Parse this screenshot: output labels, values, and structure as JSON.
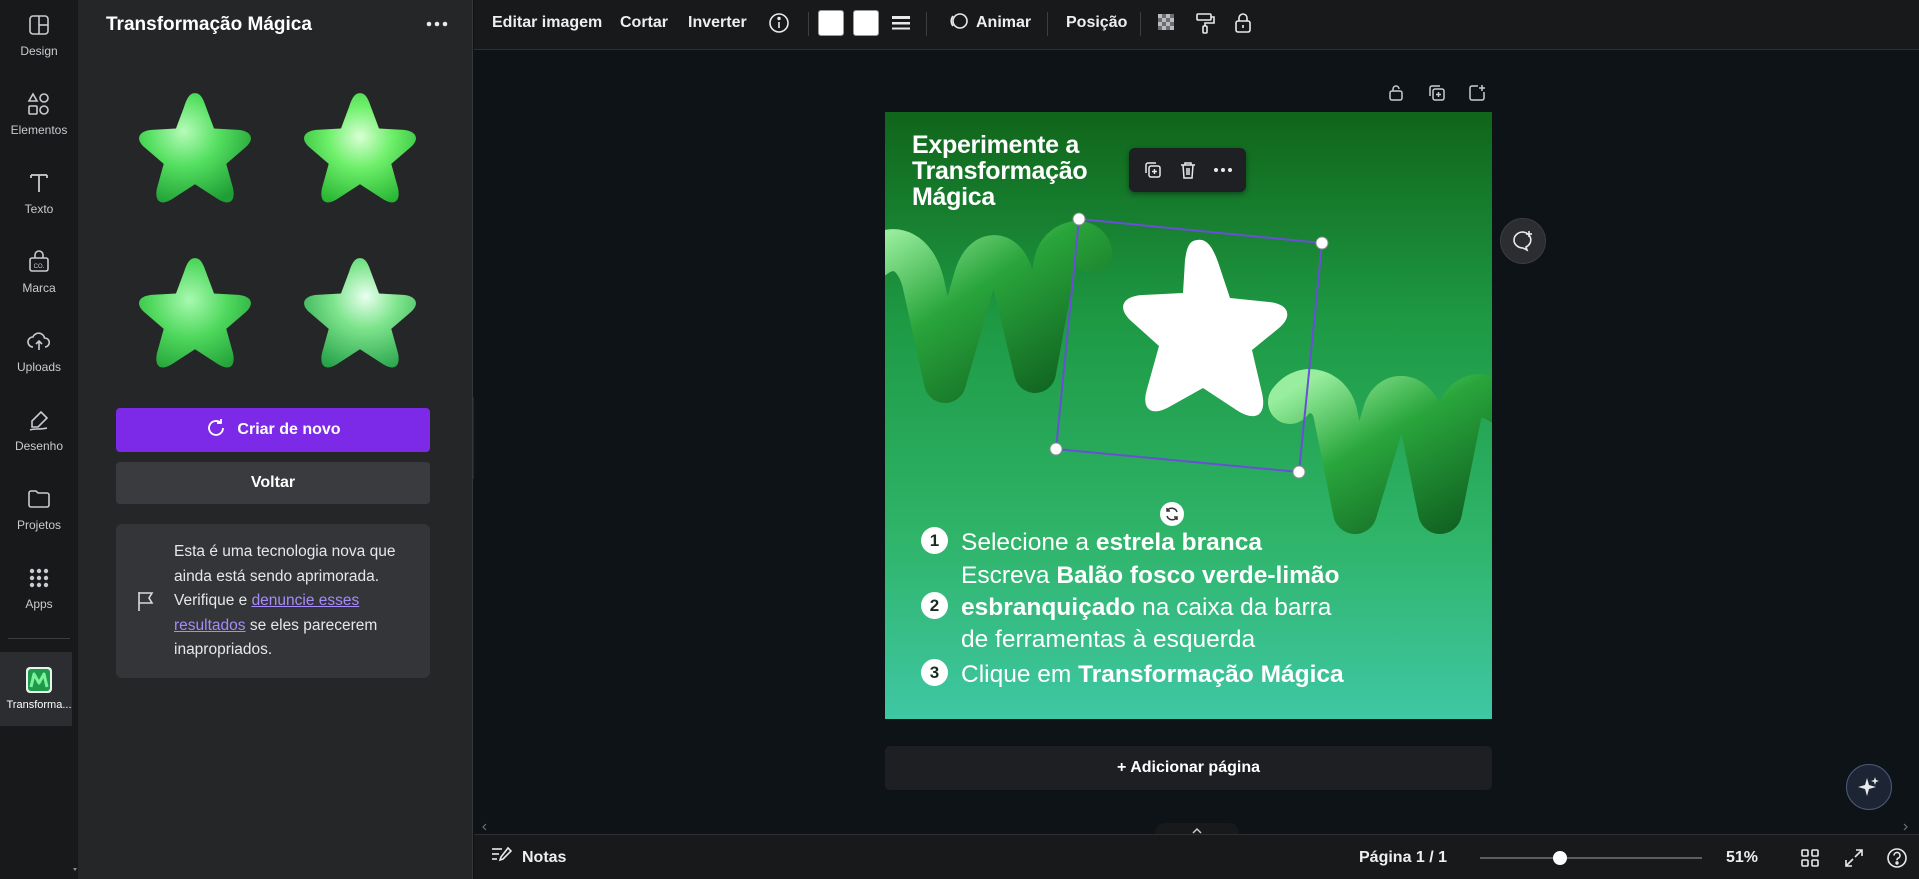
{
  "app": {
    "accent": "#7d2ae8"
  },
  "rail": {
    "items": [
      {
        "label": "Design",
        "icon": "design-icon"
      },
      {
        "label": "Elementos",
        "icon": "elements-icon"
      },
      {
        "label": "Texto",
        "icon": "text-icon"
      },
      {
        "label": "Marca",
        "icon": "brand-icon"
      },
      {
        "label": "Uploads",
        "icon": "upload-icon"
      },
      {
        "label": "Desenho",
        "icon": "draw-icon"
      },
      {
        "label": "Projetos",
        "icon": "folder-icon"
      },
      {
        "label": "Apps",
        "icon": "apps-icon"
      }
    ],
    "active_app": {
      "label": "Transforma...",
      "icon": "magic-transform-app-icon"
    }
  },
  "panel": {
    "title": "Transformação Mágica",
    "results": [
      {
        "name": "star-result-1"
      },
      {
        "name": "star-result-2"
      },
      {
        "name": "star-result-3"
      },
      {
        "name": "star-result-4"
      }
    ],
    "create_again": "Criar de novo",
    "back": "Voltar",
    "notice": {
      "text_before": "Esta é uma tecnologia nova que ainda está sendo aprimorada. Verifique e ",
      "link": "denuncie esses resultados",
      "text_after": " se eles parecerem inapropriados."
    }
  },
  "toolbar": {
    "edit_image": "Editar imagem",
    "crop": "Cortar",
    "flip": "Inverter",
    "animate": "Animar",
    "position": "Posição"
  },
  "canvas": {
    "heading": "Experimente a Transformação Mágica",
    "steps": [
      {
        "num": "1",
        "plain_before": "Selecione a ",
        "bold": "estrela branca",
        "plain_after": ""
      },
      {
        "num": "2",
        "plain_before": "Escreva ",
        "bold": "Balão fosco verde-limão esbranquiçado",
        "plain_after": " na caixa da barra de ferramentas à esquerda"
      },
      {
        "num": "3",
        "plain_before": "Clique em ",
        "bold": "Transformação Mágica",
        "plain_after": ""
      }
    ],
    "add_page": "+ Adicionar página"
  },
  "bottombar": {
    "notes": "Notas",
    "page_indicator": "Página 1 / 1",
    "zoom": "51%",
    "zoom_fraction": 0.36
  }
}
